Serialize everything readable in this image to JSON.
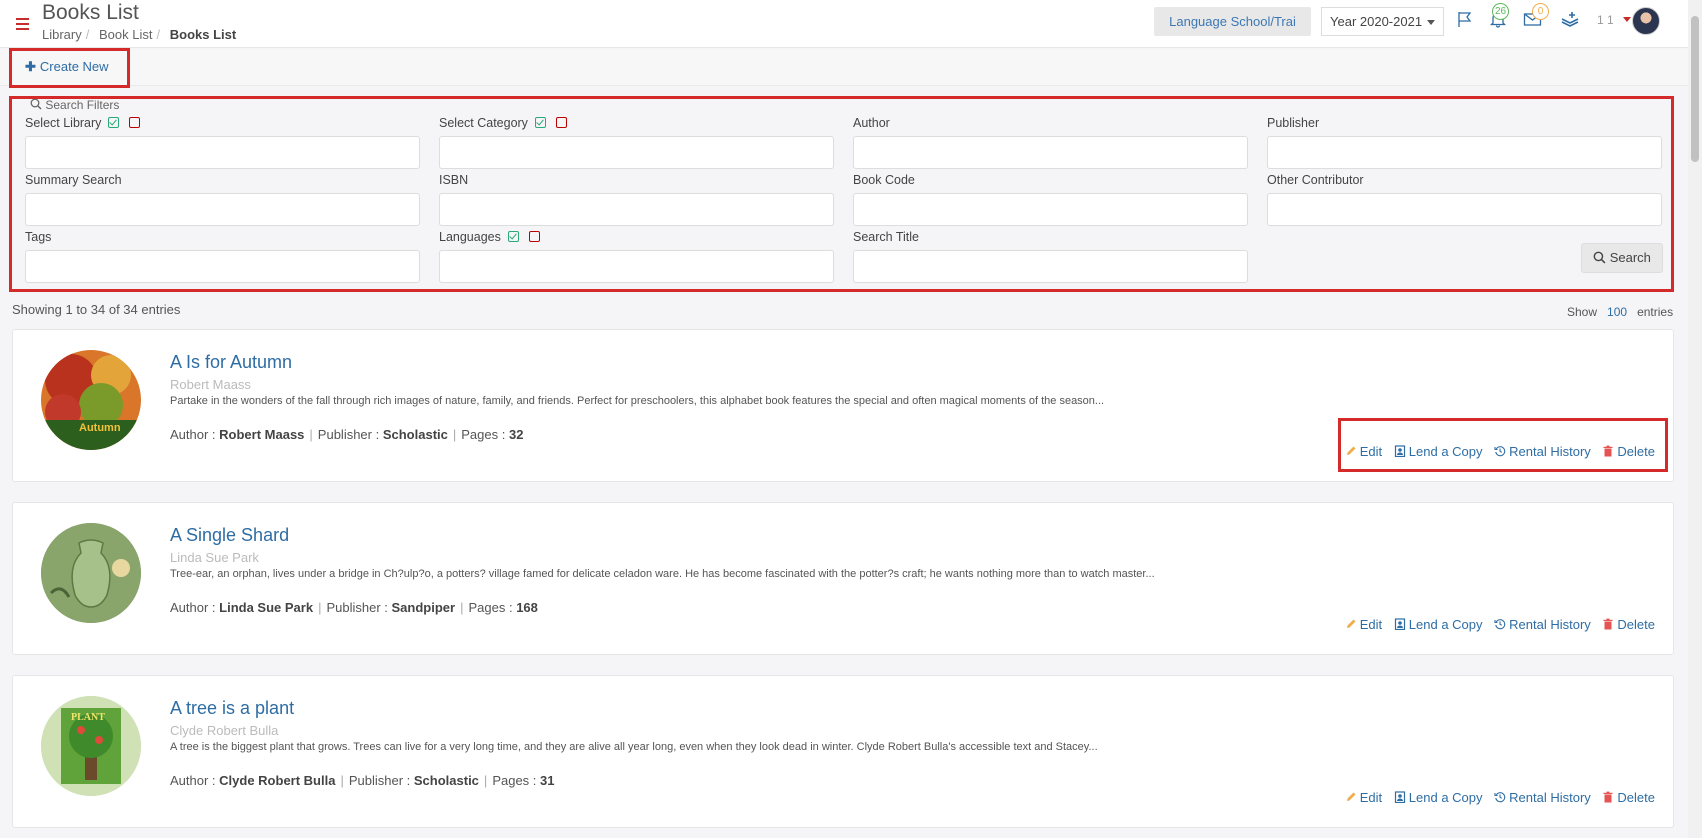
{
  "header": {
    "title": "Books List",
    "breadcrumb": [
      "Library",
      "Book List",
      "Books List"
    ],
    "school": "Language School/Trai",
    "year": "Year 2020-2021",
    "notifications_count": "26",
    "messages_count": "0",
    "user_count": "1 1"
  },
  "toolbar": {
    "create_new": "Create New"
  },
  "filters": {
    "legend": "Search Filters",
    "fields": {
      "library": "Select Library",
      "category": "Select Category",
      "author": "Author",
      "publisher": "Publisher",
      "summary": "Summary Search",
      "isbn": "ISBN",
      "book_code": "Book Code",
      "other_contributor": "Other Contributor",
      "tags": "Tags",
      "languages": "Languages",
      "search_title": "Search Title"
    },
    "search_button": "Search"
  },
  "results": {
    "showing": "Showing 1 to 34 of 34 entries",
    "show_label": "Show",
    "page_size": "100",
    "entries_label": "entries"
  },
  "labels": {
    "author": "Author :",
    "publisher": "Publisher :",
    "pages": "Pages :"
  },
  "actions": {
    "edit": "Edit",
    "lend": "Lend a Copy",
    "history": "Rental History",
    "delete": "Delete"
  },
  "books": [
    {
      "title": "A Is for Autumn",
      "author": "Robert Maass",
      "summary": "Partake in the wonders of the fall through rich images of nature, family, and friends. Perfect for preschoolers, this alphabet book features the special and often magical moments of the season...",
      "publisher": "Scholastic",
      "pages": "32"
    },
    {
      "title": "A Single Shard",
      "author": "Linda Sue Park",
      "summary": "Tree-ear, an orphan, lives under a bridge in Ch?ulp?o, a potters? village famed for delicate celadon ware. He has become fascinated with the potter?s craft; he wants nothing more than to watch master...",
      "publisher": "Sandpiper",
      "pages": "168"
    },
    {
      "title": "A tree is a plant",
      "author": "Clyde Robert Bulla",
      "summary": "A tree is the biggest plant that grows. Trees can live for a very long time, and they are alive all year long, even when they look dead in winter. Clyde Robert Bulla's accessible text and Stacey...",
      "publisher": "Scholastic",
      "pages": "31"
    }
  ]
}
